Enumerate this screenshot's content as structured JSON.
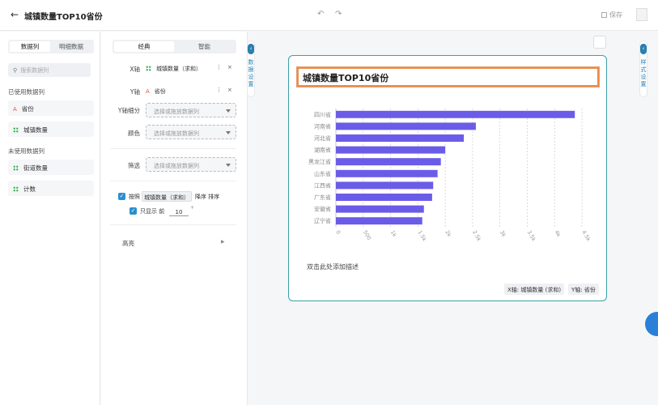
{
  "header": {
    "title": "城镇数量TOP10省份",
    "save_label": "保存"
  },
  "left_panel": {
    "tabs": [
      "数据列",
      "明细数据"
    ],
    "search_placeholder": "搜索数据列",
    "used_title": "已使用数据列",
    "used_fields": [
      {
        "label": "省份",
        "type": "text"
      },
      {
        "label": "城镇数量",
        "type": "number"
      }
    ],
    "unused_title": "未使用数据列",
    "unused_fields": [
      {
        "label": "街道数量",
        "type": "number"
      },
      {
        "label": "计数",
        "type": "number"
      }
    ]
  },
  "config_panel": {
    "tabs": [
      "经典",
      "智能"
    ],
    "x_axis_label": "X轴",
    "x_axis_value": "城镇数量（求和）",
    "y_axis_label": "Y轴",
    "y_axis_value": "省份",
    "y_sub_label": "Y轴细分",
    "y_sub_placeholder": "选择或拖放数据列",
    "color_label": "颜色",
    "color_placeholder": "选择或拖放数据列",
    "filter_label": "筛选",
    "filter_placeholder": "选择或拖放数据列",
    "sort_prefix": "按照",
    "sort_field": "城镇数量（求和）",
    "sort_order": "降序 排序",
    "topn_prefix": "只显示 前",
    "topn_value": "10",
    "highlight_label": "高亮"
  },
  "side_tabs": {
    "data_settings": "数据设置",
    "style_settings": "样式设置"
  },
  "chart_card": {
    "description": "双击此处添加描述",
    "x_tag": "X轴: 城镇数量 (求和)",
    "y_tag": "Y轴: 省份"
  },
  "chart_data": {
    "type": "bar",
    "orientation": "horizontal",
    "title": "城镇数量TOP10省份",
    "categories": [
      "四川省",
      "河南省",
      "河北省",
      "湖南省",
      "黑龙江省",
      "山东省",
      "江西省",
      "广东省",
      "安徽省",
      "辽宁省"
    ],
    "values": [
      4370,
      2560,
      2340,
      2000,
      1920,
      1860,
      1780,
      1760,
      1610,
      1580
    ],
    "xlim": [
      0,
      4500
    ],
    "xticks": [
      "0",
      "500",
      "1k",
      "1.5k",
      "2k",
      "2.5k",
      "3k",
      "3.5k",
      "4k",
      "4.5k"
    ],
    "bar_color": "#6b5ce7",
    "grid": true
  },
  "colors": {
    "accent": "#2a7fb0",
    "title_border": "#f08a4b",
    "card_border": "#3aa0a8"
  }
}
